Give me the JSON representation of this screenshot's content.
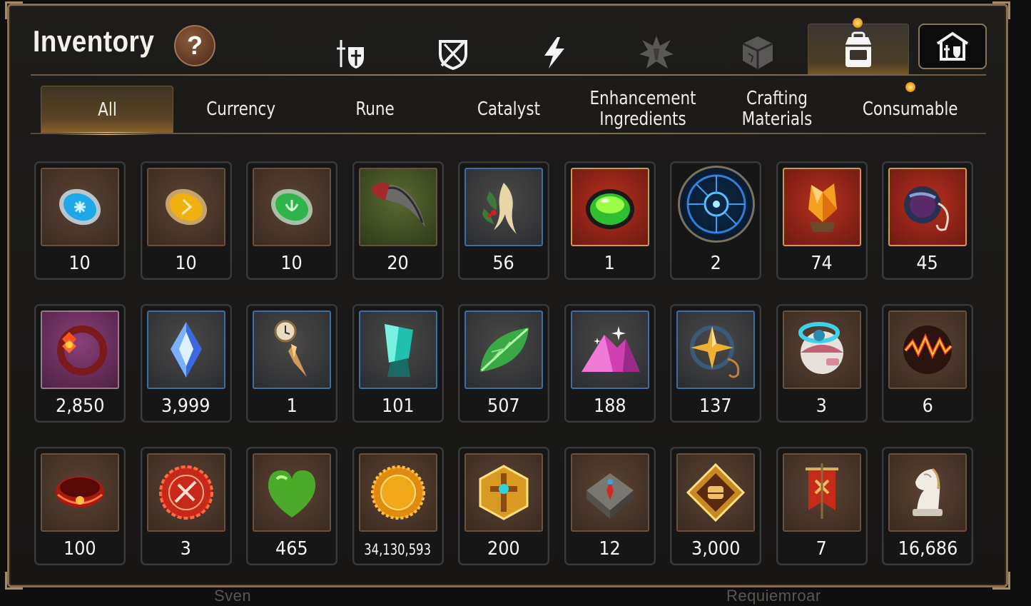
{
  "header": {
    "title": "Inventory",
    "help_label": "?"
  },
  "category_icons": [
    {
      "name": "equipment-icon",
      "active": false
    },
    {
      "name": "artifact-icon",
      "active": false
    },
    {
      "name": "skill-icon",
      "active": false
    },
    {
      "name": "fragment-icon",
      "active": false
    },
    {
      "name": "cube-icon",
      "active": false
    },
    {
      "name": "backpack-icon",
      "active": true
    }
  ],
  "storage_button": {
    "icon": "storage-house-icon"
  },
  "tabs": [
    {
      "label": "All",
      "active": true
    },
    {
      "label": "Currency"
    },
    {
      "label": "Rune"
    },
    {
      "label": "Catalyst"
    },
    {
      "label": "Enhancement Ingredients"
    },
    {
      "label": "Crafting Materials"
    },
    {
      "label": "Consumable"
    }
  ],
  "items": [
    {
      "icon": "blue-rune-icon",
      "count": "10"
    },
    {
      "icon": "yellow-rune-icon",
      "count": "10"
    },
    {
      "icon": "green-rune-icon",
      "count": "10"
    },
    {
      "icon": "claw-icon",
      "count": "20"
    },
    {
      "icon": "root-herb-icon",
      "count": "56"
    },
    {
      "icon": "green-pot-icon",
      "count": "1"
    },
    {
      "icon": "blue-sigil-disc-icon",
      "count": "2"
    },
    {
      "icon": "orange-crystal-icon",
      "count": "74"
    },
    {
      "icon": "red-amulet-icon",
      "count": "45"
    },
    {
      "icon": "flower-ring-icon",
      "count": "2,850"
    },
    {
      "icon": "blue-gem-icon",
      "count": "3,999"
    },
    {
      "icon": "pendulum-icon",
      "count": "1"
    },
    {
      "icon": "teal-crystal-icon",
      "count": "101"
    },
    {
      "icon": "leaf-icon",
      "count": "507"
    },
    {
      "icon": "pink-powder-pile-icon",
      "count": "188"
    },
    {
      "icon": "star-amulet-icon",
      "count": "137"
    },
    {
      "icon": "capsule-orb-icon",
      "count": "3"
    },
    {
      "icon": "lava-orb-icon",
      "count": "6"
    },
    {
      "icon": "red-bracelet-icon",
      "count": "100"
    },
    {
      "icon": "red-badge-icon",
      "count": "3"
    },
    {
      "icon": "green-heart-icon",
      "count": "465"
    },
    {
      "icon": "gold-coin-icon",
      "count": "34,130,593"
    },
    {
      "icon": "gold-hexagon-emblem-icon",
      "count": "200"
    },
    {
      "icon": "stone-compass-icon",
      "count": "12"
    },
    {
      "icon": "fist-emblem-icon",
      "count": "3,000"
    },
    {
      "icon": "red-banner-icon",
      "count": "7"
    },
    {
      "icon": "knight-chess-piece-icon",
      "count": "16,686"
    }
  ],
  "background_names": [
    "Sven",
    "Requiemroar"
  ]
}
